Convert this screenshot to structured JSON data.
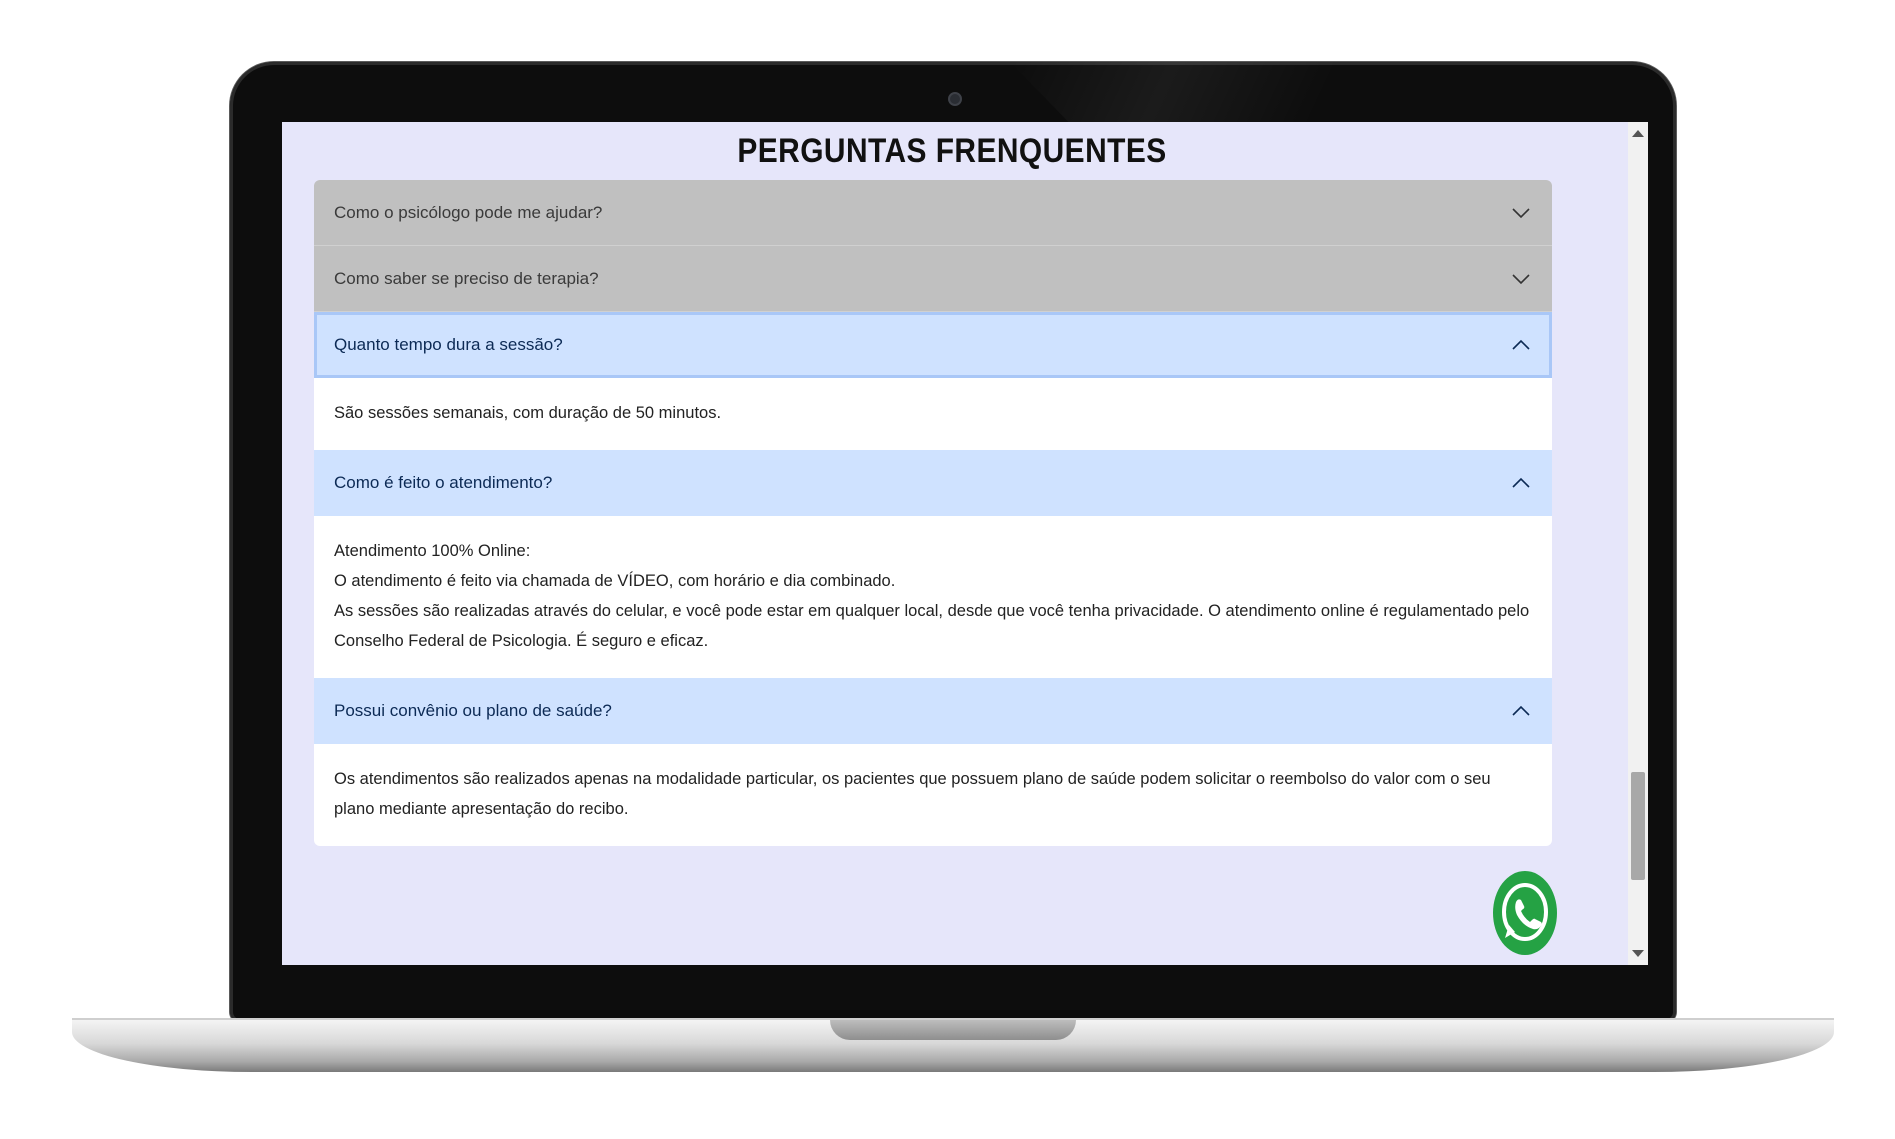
{
  "page": {
    "title": "PERGUNTAS FRENQUENTES"
  },
  "faq": [
    {
      "question": "Como o psicólogo pode me ajudar?",
      "state": "collapsed",
      "answer": []
    },
    {
      "question": "Como saber se preciso de terapia?",
      "state": "collapsed",
      "answer": []
    },
    {
      "question": "Quanto tempo dura a sessão?",
      "state": "open",
      "answer": [
        "São sessões semanais, com duração de 50 minutos."
      ]
    },
    {
      "question": "Como é feito o atendimento?",
      "state": "open",
      "answer": [
        "Atendimento 100% Online:",
        "O atendimento é feito via chamada de VÍDEO, com horário e dia combinado.",
        "As sessões são realizadas através do celular, e você pode estar em qualquer local, desde que você tenha privacidade. O atendimento online é regulamentado pelo Conselho Federal de Psicologia. É seguro e eficaz."
      ]
    },
    {
      "question": "Possui convênio ou plano de saúde?",
      "state": "open",
      "answer": [
        "Os atendimentos são realizados apenas na modalidade particular, os pacientes que possuem plano de saúde podem solicitar o reembolso do valor com o seu plano mediante apresentação do recibo."
      ]
    }
  ],
  "icons": {
    "collapsed_chevron": "chevron-down-icon",
    "open_chevron": "chevron-up-icon",
    "floating_button": "whatsapp-icon"
  },
  "colors": {
    "page_background": "#e6e6fa",
    "collapsed_header": "#c0c0c0",
    "open_header": "#cfe2ff",
    "whatsapp_green": "#25a244"
  }
}
